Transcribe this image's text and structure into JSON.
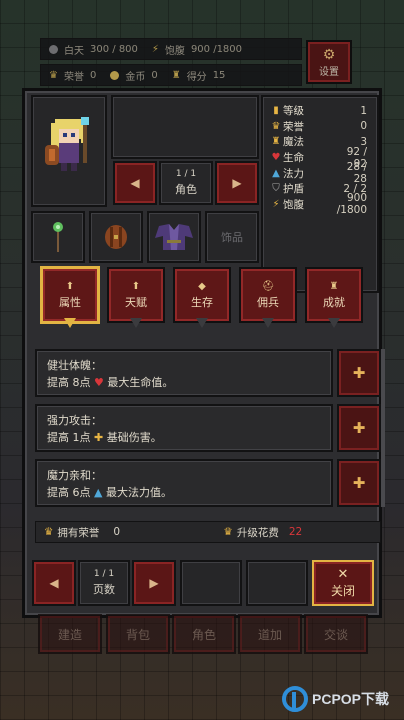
{
  "status": {
    "day_label": "白天",
    "day_value": "300 / 800",
    "hunger_label": "饱腹",
    "hunger_value": "900 /1800",
    "honor_label": "荣誉",
    "honor_value": "0",
    "gold_label": "金币",
    "gold_value": "0",
    "score_label": "得分",
    "score_value": "15"
  },
  "settings_label": "设置",
  "character": {
    "page": "1 / 1",
    "role_label": "角色",
    "accessory_label": "饰品"
  },
  "stats": [
    {
      "icon": "level-icon",
      "label": "等级",
      "value": "1",
      "color": "#e7b544"
    },
    {
      "icon": "crown-icon",
      "label": "荣誉",
      "value": "0",
      "color": "#e7b544"
    },
    {
      "icon": "magic-icon",
      "label": "魔法",
      "value": "3",
      "color": "#e7b544"
    },
    {
      "icon": "heart-icon",
      "label": "生命",
      "value": "92 / 92",
      "color": "#d8363a"
    },
    {
      "icon": "mana-icon",
      "label": "法力",
      "value": "28 / 28",
      "color": "#4fa7d8"
    },
    {
      "icon": "shield-icon",
      "label": "护盾",
      "value": "2 / 2",
      "color": "#a9a9a9"
    },
    {
      "icon": "hunger-icon",
      "label": "饱腹",
      "value": "900 /1800",
      "color": "#e7b544"
    }
  ],
  "tabs": [
    {
      "label": "属性",
      "icon": "up-arrow-icon",
      "active": true
    },
    {
      "label": "天赋",
      "icon": "up-arrow-icon",
      "active": false
    },
    {
      "label": "生存",
      "icon": "diamond-icon",
      "active": false
    },
    {
      "label": "佣兵",
      "icon": "helmet-icon",
      "active": false
    },
    {
      "label": "成就",
      "icon": "trophy-icon",
      "active": false
    }
  ],
  "skills": [
    {
      "title": "健壮体魄：",
      "pre": "提高 8点",
      "icon": "heart-icon",
      "post": "最大生命值。"
    },
    {
      "title": "强力攻击：",
      "pre": "提高 1点",
      "icon": "attack-plus-icon",
      "post": "基础伤害。"
    },
    {
      "title": "魔力亲和：",
      "pre": "提高 6点",
      "icon": "mana-icon",
      "post": "最大法力值。"
    }
  ],
  "footer": {
    "honor_label": "拥有荣誉",
    "honor_value": "0",
    "cost_label": "升级花费",
    "cost_value": "22"
  },
  "pager": {
    "page": "1 / 1",
    "label": "页数",
    "close_label": "关闭"
  },
  "nav": [
    "建造",
    "背包",
    "角色",
    "道加",
    "交谈"
  ],
  "watermark": "PCPOP下载"
}
